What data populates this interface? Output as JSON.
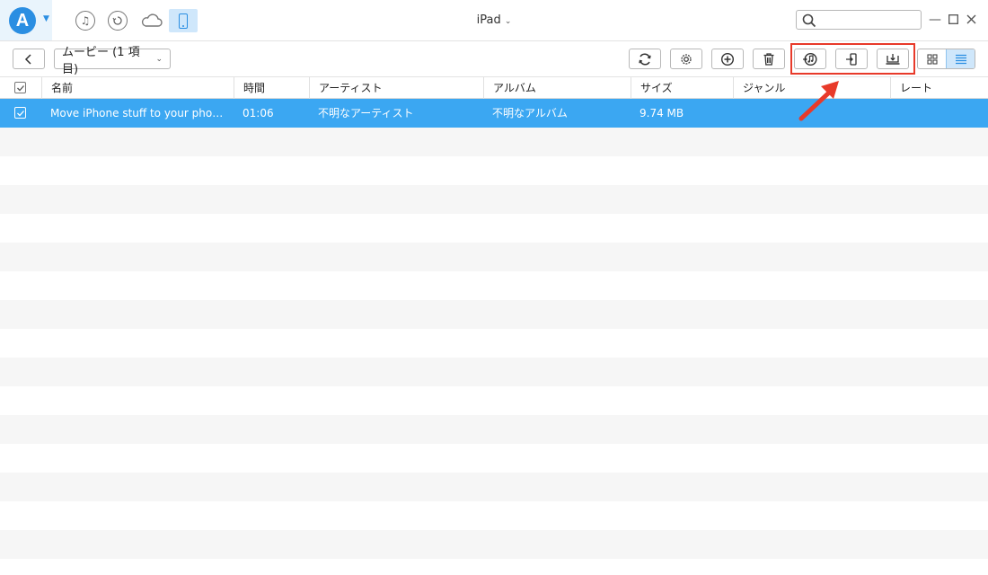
{
  "app": {
    "logo_letter": "A",
    "device_title": "iPad",
    "accent": "#2a8ee2",
    "selection_color": "#3ba7f2",
    "highlight_color": "#e83a2a"
  },
  "nav": {
    "icons": [
      "music-icon",
      "history-icon",
      "cloud-icon",
      "device-icon"
    ]
  },
  "search": {
    "value": "",
    "placeholder": ""
  },
  "toolbar": {
    "category_label": "ムービー (1 項目)",
    "buttons": [
      "refresh-icon",
      "settings-icon",
      "add-icon",
      "delete-icon",
      "to-itunes-icon",
      "to-device-icon",
      "to-computer-icon"
    ]
  },
  "table": {
    "columns": {
      "name": "名前",
      "time": "時間",
      "artist": "アーティスト",
      "album": "アルバム",
      "size": "サイズ",
      "genre": "ジャンル",
      "rating": "レート"
    },
    "rows": [
      {
        "name": "Move iPhone stuff to your phone...",
        "time": "01:06",
        "artist": "不明なアーティスト",
        "album": "不明なアルバム",
        "size": "9.74 MB",
        "genre": "",
        "rating": "",
        "selected": true
      }
    ]
  }
}
